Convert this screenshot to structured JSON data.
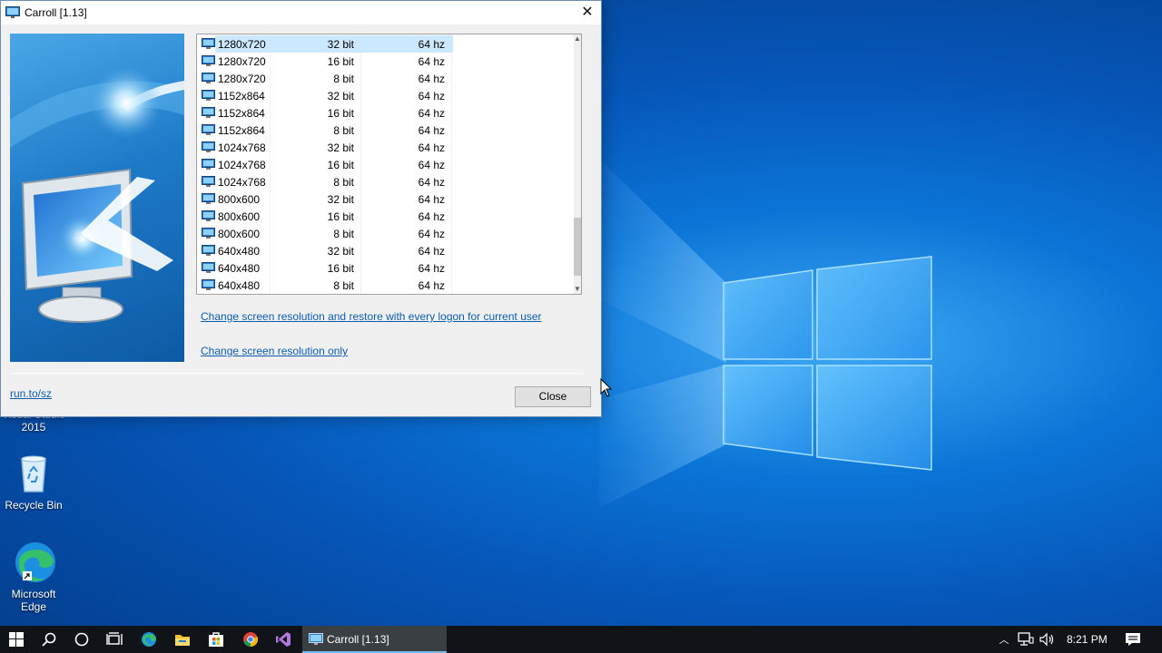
{
  "window": {
    "title": "Carroll [1.13]",
    "close_glyph": "✕"
  },
  "resolutions": [
    {
      "res": "1280x720",
      "depth": "32 bit",
      "freq": "64 hz",
      "selected": true
    },
    {
      "res": "1280x720",
      "depth": "16 bit",
      "freq": "64 hz"
    },
    {
      "res": "1280x720",
      "depth": "8 bit",
      "freq": "64 hz"
    },
    {
      "res": "1152x864",
      "depth": "32 bit",
      "freq": "64 hz"
    },
    {
      "res": "1152x864",
      "depth": "16 bit",
      "freq": "64 hz"
    },
    {
      "res": "1152x864",
      "depth": "8 bit",
      "freq": "64 hz"
    },
    {
      "res": "1024x768",
      "depth": "32 bit",
      "freq": "64 hz"
    },
    {
      "res": "1024x768",
      "depth": "16 bit",
      "freq": "64 hz"
    },
    {
      "res": "1024x768",
      "depth": "8 bit",
      "freq": "64 hz"
    },
    {
      "res": "800x600",
      "depth": "32 bit",
      "freq": "64 hz"
    },
    {
      "res": "800x600",
      "depth": "16 bit",
      "freq": "64 hz"
    },
    {
      "res": "800x600",
      "depth": "8 bit",
      "freq": "64 hz"
    },
    {
      "res": "640x480",
      "depth": "32 bit",
      "freq": "64 hz"
    },
    {
      "res": "640x480",
      "depth": "16 bit",
      "freq": "64 hz"
    },
    {
      "res": "640x480",
      "depth": "8 bit",
      "freq": "64 hz"
    }
  ],
  "links": {
    "restore_every_logon": "Change screen resolution and restore with every logon for current user",
    "only": "Change screen resolution only",
    "website": "run.to/sz"
  },
  "buttons": {
    "close": "Close"
  },
  "desktop": {
    "icons": [
      {
        "label_line1": "Visual Studio",
        "label_line2": "2015"
      },
      {
        "label_line1": "Recycle Bin",
        "label_line2": ""
      },
      {
        "label_line1": "Microsoft",
        "label_line2": "Edge"
      }
    ]
  },
  "taskbar": {
    "active_window_label": "Carroll [1.13]",
    "clock": "8:21 PM",
    "icons": [
      "start-icon",
      "search-icon",
      "cortana-icon",
      "task-view-icon",
      "edge-icon",
      "file-explorer-icon",
      "store-icon",
      "chrome-icon",
      "visual-studio-icon"
    ]
  },
  "colors": {
    "accent": "#0078d7",
    "selection": "#cce8ff",
    "link": "#0b5dac",
    "taskbar": "#101418"
  }
}
